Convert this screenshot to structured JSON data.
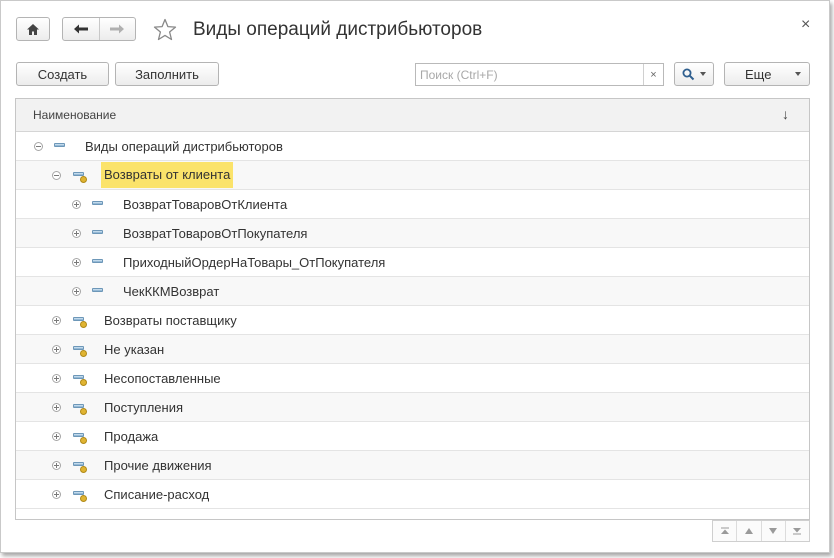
{
  "window": {
    "title": "Виды операций дистрибьюторов",
    "close_glyph": "×"
  },
  "toolbar": {
    "create_label": "Создать",
    "fill_label": "Заполнить",
    "search_placeholder": "Поиск (Ctrl+F)",
    "search_clear_glyph": "×",
    "more_label": "Еще"
  },
  "table": {
    "column_header": "Наименование",
    "sort_glyph": "↓",
    "rows": [
      {
        "label": "Виды операций дистрибьюторов",
        "level": 0,
        "expanded": true,
        "icon": "element-icon"
      },
      {
        "label": "Возвраты от клиента",
        "level": 1,
        "expanded": true,
        "icon": "folder-icon",
        "selected": true
      },
      {
        "label": "ВозвратТоваровОтКлиента",
        "level": 2,
        "expanded": false,
        "icon": "element-icon"
      },
      {
        "label": "ВозвратТоваровОтПокупателя",
        "level": 2,
        "expanded": false,
        "icon": "element-icon"
      },
      {
        "label": "ПриходныйОрдерНаТовары_ОтПокупателя",
        "level": 2,
        "expanded": false,
        "icon": "element-icon"
      },
      {
        "label": "ЧекККМВозврат",
        "level": 2,
        "expanded": false,
        "icon": "element-icon"
      },
      {
        "label": "Возвраты поставщику",
        "level": 1,
        "expanded": false,
        "icon": "folder-icon"
      },
      {
        "label": "Не указан",
        "level": 1,
        "expanded": false,
        "icon": "folder-icon"
      },
      {
        "label": "Несопоставленные",
        "level": 1,
        "expanded": false,
        "icon": "folder-icon"
      },
      {
        "label": "Поступления",
        "level": 1,
        "expanded": false,
        "icon": "folder-icon"
      },
      {
        "label": "Продажа",
        "level": 1,
        "expanded": false,
        "icon": "folder-icon"
      },
      {
        "label": "Прочие движения",
        "level": 1,
        "expanded": false,
        "icon": "folder-icon"
      },
      {
        "label": "Списание-расход",
        "level": 1,
        "expanded": false,
        "icon": "folder-icon"
      }
    ]
  },
  "colors": {
    "selection_highlight": "#fbe36a",
    "header_bg": "#f2f2f2",
    "border": "#c6c6c6"
  }
}
